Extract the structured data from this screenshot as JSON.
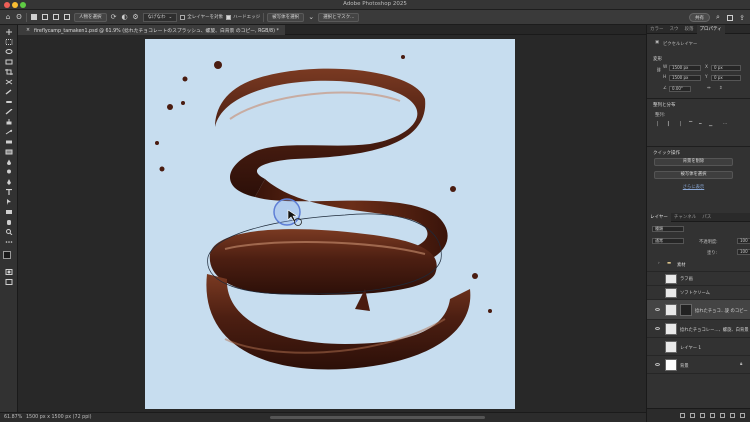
{
  "window": {
    "title": "Adobe Photoshop 2025"
  },
  "options_bar": {
    "select_subject_label": "人物を選択",
    "sample_select": "なげなわ",
    "sample_all_layers_label": "全レイヤーを対象",
    "enhance_edge_label": "ハードエッジ",
    "select_subject_button": "被写体を選択",
    "select_mask_button": "選択とマスク...",
    "share_button": "共有"
  },
  "document_tab": {
    "label": "fireflycamp_tamaken1.psd @ 61.9% (捻れたチョコレートのスプラッシュ、螺旋、白背景 のコピー, RGB/8) *"
  },
  "status_bar": {
    "zoom": "61.87%",
    "dimensions": "1500 px x 1500 px (72 ppi)"
  },
  "right_panel": {
    "top_tabs": [
      "カラー",
      "スウ",
      "段落",
      "プロパティ"
    ],
    "pixel_layer_label": "ピクセルレイヤー",
    "transform_title": "変形",
    "w_label": "W",
    "w_value": "1500 px",
    "h_label": "H",
    "h_value": "1500 px",
    "x_label": "X",
    "x_value": "0 px",
    "y_label": "Y",
    "y_value": "0 px",
    "angle_value": "0.00°",
    "align_title": "整列と分布",
    "align_label": "整列:",
    "quick_actions_title": "クイック操作",
    "remove_bg_button": "背景を削除",
    "select_subject_button": "被写体を選択",
    "more_link": "さらに表示",
    "layer_tabs": [
      "レイヤー",
      "チャンネル",
      "パス"
    ],
    "filter_kind": "種類",
    "blend_mode": "通常",
    "opacity_label": "不透明度:",
    "opacity_value": "100",
    "fill_label": "塗り:",
    "fill_value": "100",
    "layers": [
      {
        "name": "素材",
        "type": "group"
      },
      {
        "name": "ラフ画",
        "type": "layer"
      },
      {
        "name": "ソフトクリーム",
        "type": "layer"
      },
      {
        "name": "捻れたチョコ...旋 のコピー",
        "type": "layer"
      },
      {
        "name": "捻れたチョコレー...、螺旋、白背景",
        "type": "layer"
      },
      {
        "name": "レイヤー 1",
        "type": "layer"
      },
      {
        "name": "背景",
        "type": "layer"
      }
    ]
  },
  "colors": {
    "canvas_bg": "#c7ddef",
    "chocolate": "#4a1c10",
    "selected_layer": "#444444"
  }
}
